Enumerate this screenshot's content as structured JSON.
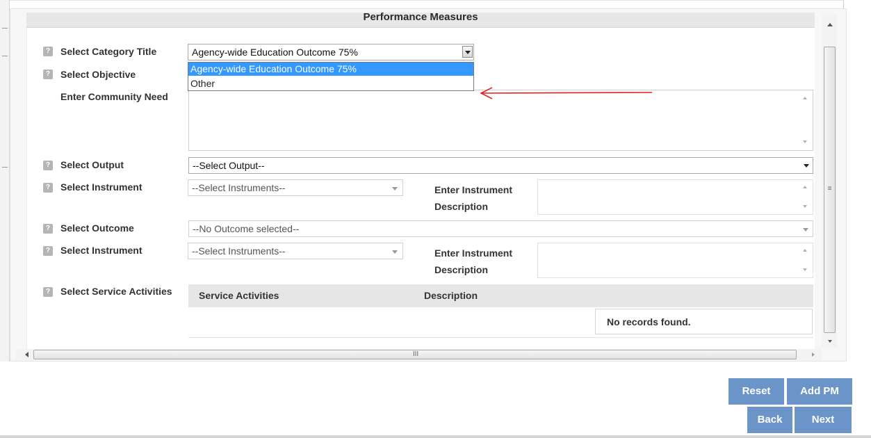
{
  "section": {
    "title": "Performance Measures"
  },
  "labels": {
    "category_title": "Select Category Title",
    "objective": "Select Objective",
    "community_need": "Enter Community Need",
    "output": "Select Output",
    "instrument_1": "Select Instrument",
    "instrument_desc_1": [
      "Enter Instrument",
      "Description"
    ],
    "outcome": "Select Outcome",
    "instrument_2": "Select Instrument",
    "instrument_desc_2": [
      "Enter Instrument",
      "Description"
    ],
    "service_activities": "Select Service Activities"
  },
  "help_icon_glyph": "?",
  "category_select": {
    "value": "Agency-wide Education Outcome 75%",
    "options": [
      "Agency-wide Education Outcome 75%",
      "Other"
    ],
    "highlighted_option": "Agency-wide Education Outcome 75%"
  },
  "output_select": {
    "value": "--Select Output--"
  },
  "instrument_select_1": {
    "value": "--Select Instruments--"
  },
  "outcome_select": {
    "value": "--No Outcome selected--"
  },
  "instrument_select_2": {
    "value": "--Select Instruments--"
  },
  "service_table": {
    "columns": [
      "Service Activities",
      "Description"
    ],
    "empty_message": "No records found."
  },
  "scrollbar": {
    "grip_vertical": "≡",
    "grip_horizontal": "III"
  },
  "buttons": {
    "reset": "Reset",
    "add_pm": "Add PM",
    "back": "Back",
    "next": "Next"
  },
  "colors": {
    "button_bg": "#6b95c9",
    "option_highlight": "#3399ff",
    "annotation_arrow": "#e02020"
  },
  "icons": [
    "help-icon",
    "dropdown-arrow-icon",
    "annotation-arrow-icon",
    "scroll-up-icon",
    "scroll-down-icon",
    "scroll-left-icon",
    "scroll-right-icon"
  ]
}
